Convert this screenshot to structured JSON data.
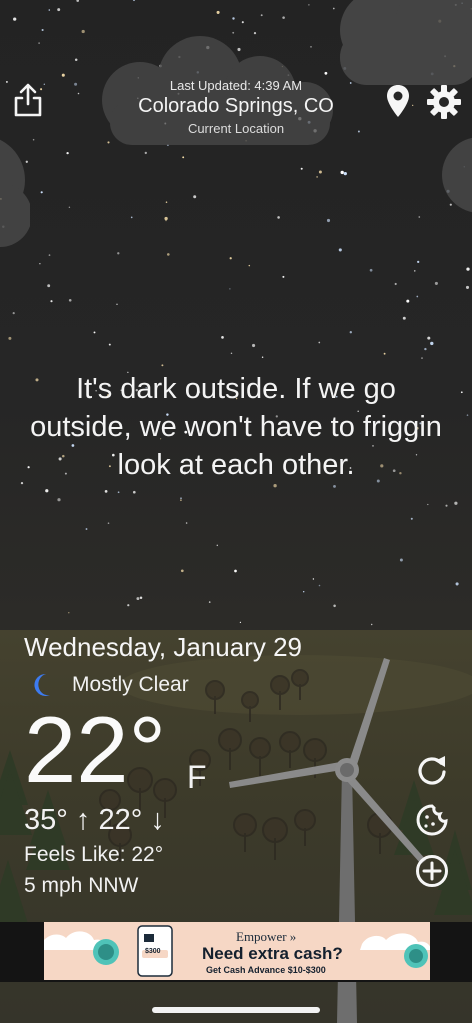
{
  "header": {
    "last_updated": "Last Updated: 4:39 AM",
    "city": "Colorado Springs, CO",
    "current_location": "Current Location"
  },
  "toolbar": {
    "share_icon": "share-icon",
    "location_icon": "map-pin-icon",
    "settings_icon": "gear-icon"
  },
  "quote": "It's dark outside. If we go outside, we won't have to friggin look at each other.",
  "weather": {
    "date": "Wednesday, January 29",
    "condition_icon": "crescent-moon-icon",
    "condition": "Mostly Clear",
    "temperature": "22°",
    "unit": "F",
    "hi_lo": "35° ↑  22° ↓",
    "feels_like": "Feels Like: 22°",
    "wind": "5 mph NNW"
  },
  "side_buttons": {
    "refresh_icon": "refresh-icon",
    "cookie_icon": "cookie-icon",
    "add_icon": "plus-circle-icon"
  },
  "ad": {
    "brand": "Empower »",
    "headline": "Need extra cash?",
    "subline": "Get Cash Advance $10-$300",
    "amount": "$300"
  },
  "colors": {
    "sky": "#262626",
    "ground": "#403e2d",
    "text": "#f2f2f2",
    "moon": "#3d7bf0",
    "ad_bg": "#f6d7c5"
  }
}
